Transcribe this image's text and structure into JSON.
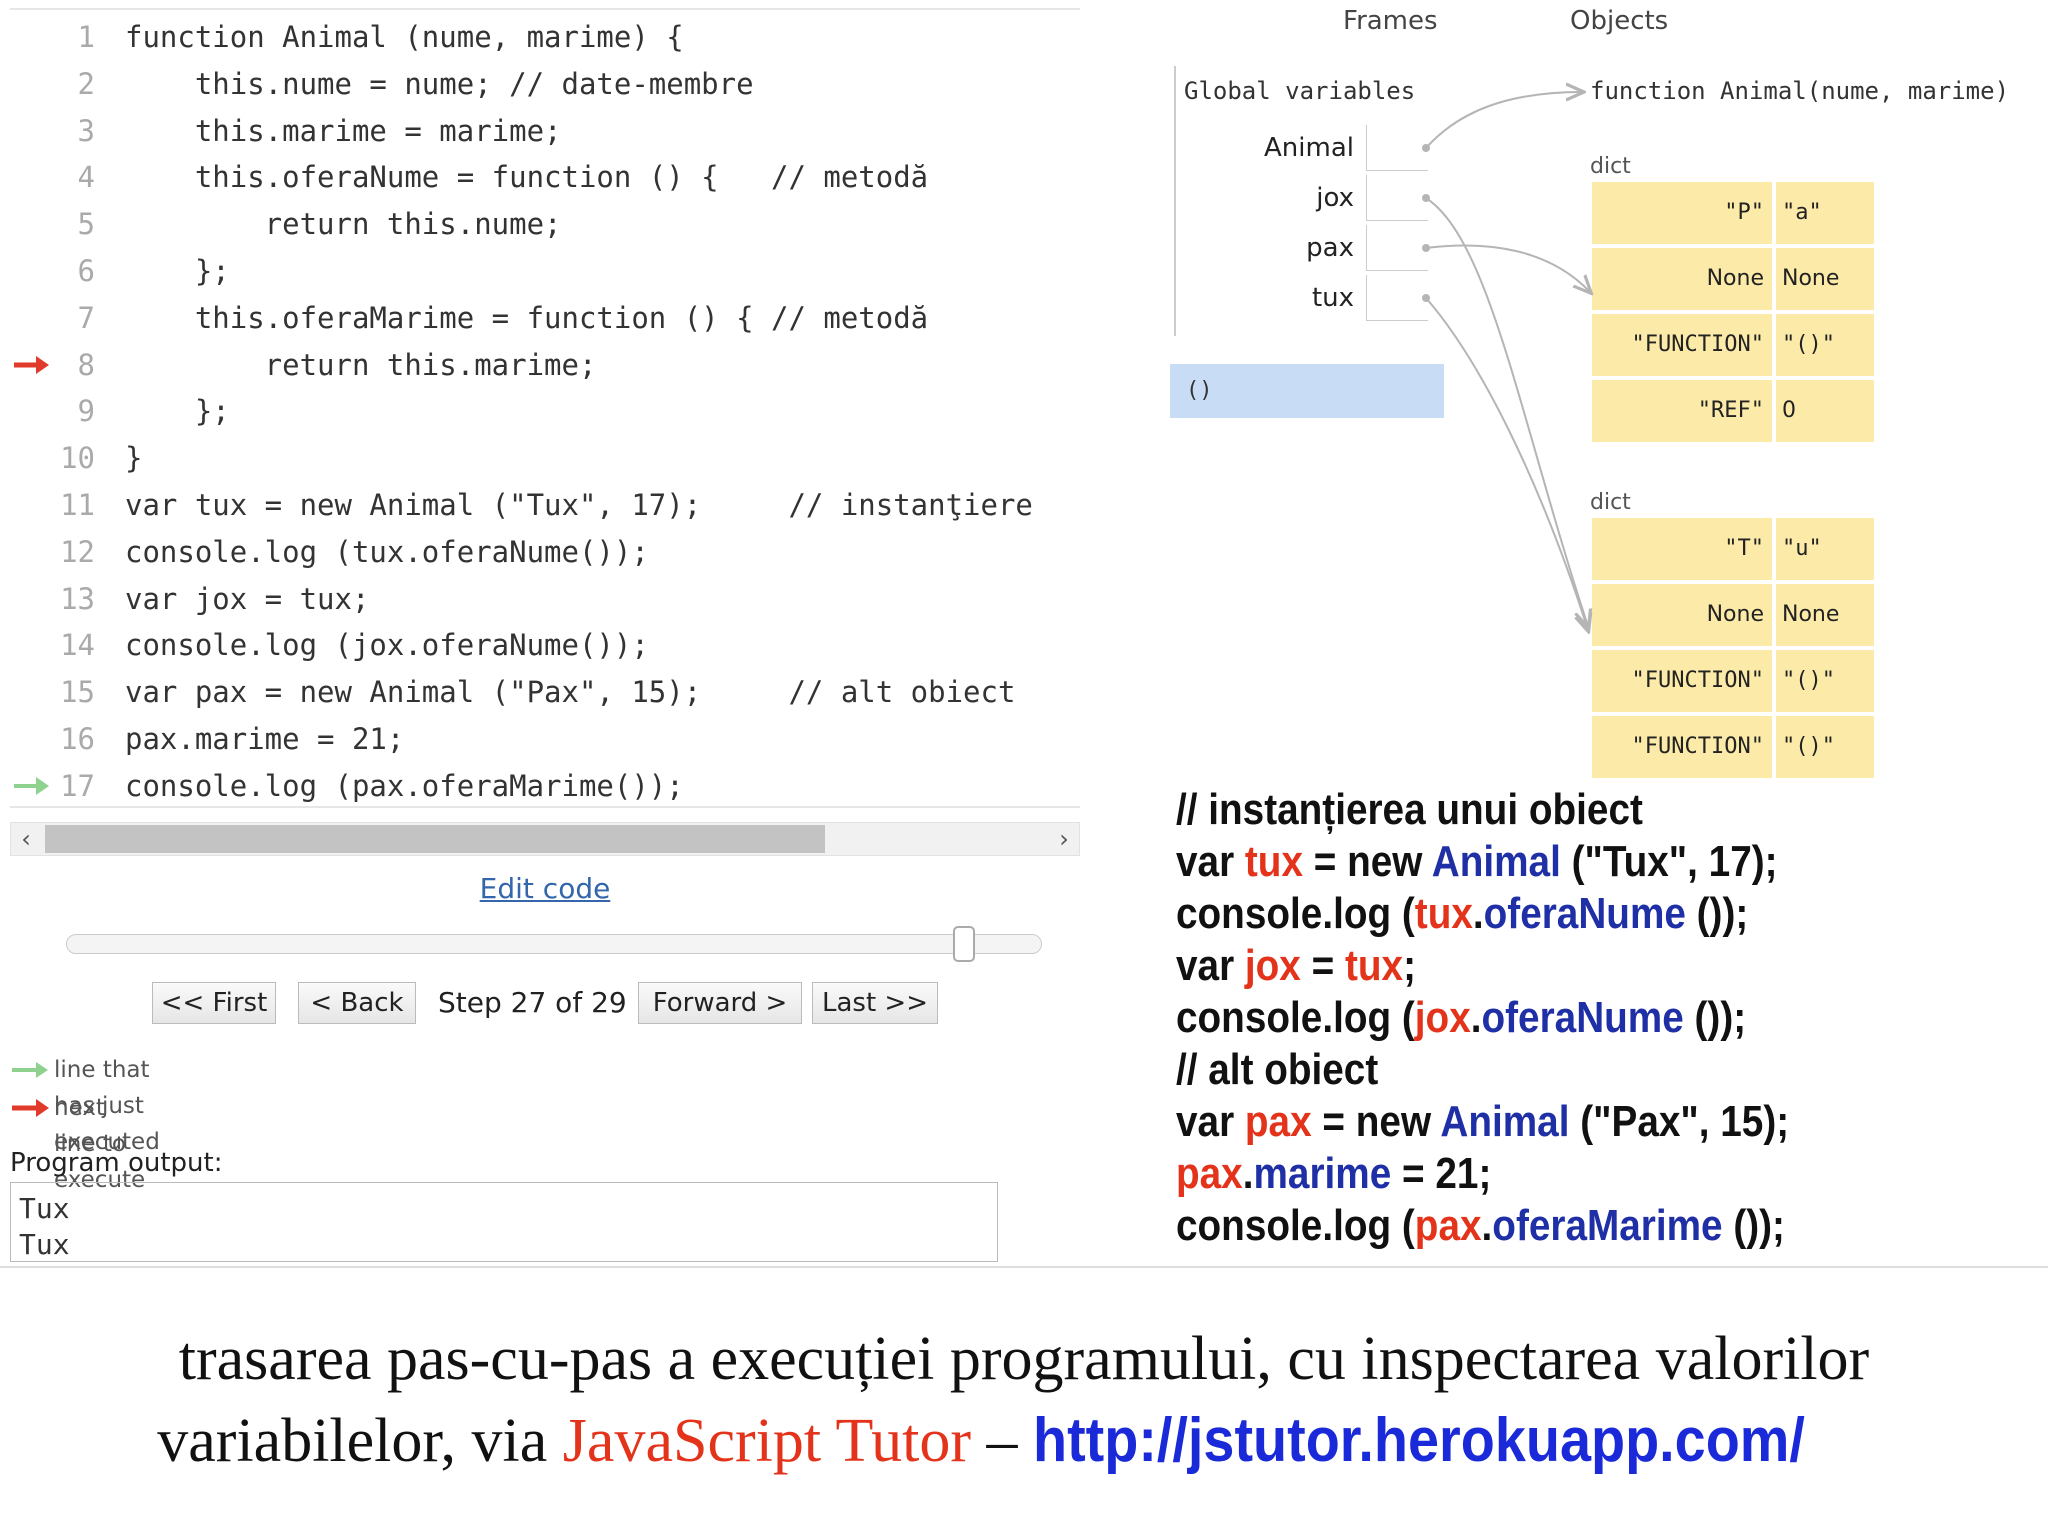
{
  "code": {
    "lines": [
      {
        "num": "1",
        "text": "function Animal (nume, marime) {"
      },
      {
        "num": "2",
        "text": "    this.nume = nume; // date-membre"
      },
      {
        "num": "3",
        "text": "    this.marime = marime;"
      },
      {
        "num": "4",
        "text": "    this.oferaNume = function () {   // metodă"
      },
      {
        "num": "5",
        "text": "        return this.nume;"
      },
      {
        "num": "6",
        "text": "    };"
      },
      {
        "num": "7",
        "text": "    this.oferaMarime = function () { // metodă"
      },
      {
        "num": "8",
        "text": "        return this.marime;"
      },
      {
        "num": "9",
        "text": "    };"
      },
      {
        "num": "10",
        "text": "}"
      },
      {
        "num": "11",
        "text": "var tux = new Animal (\"Tux\", 17);     // instanţiere"
      },
      {
        "num": "12",
        "text": "console.log (tux.oferaNume());"
      },
      {
        "num": "13",
        "text": "var jox = tux;"
      },
      {
        "num": "14",
        "text": "console.log (jox.oferaNume());"
      },
      {
        "num": "15",
        "text": "var pax = new Animal (\"Pax\", 15);     // alt obiect"
      },
      {
        "num": "16",
        "text": "pax.marime = 21;"
      },
      {
        "num": "17",
        "text": "console.log (pax.oferaMarime());"
      }
    ],
    "next_line": 8,
    "just_executed_line": 17
  },
  "controls": {
    "edit_code": "Edit code",
    "first": "<< First",
    "back": "< Back",
    "step": "Step 27 of 29",
    "forward": "Forward >",
    "last": "Last >>",
    "step_current": 27,
    "step_total": 29
  },
  "legend": {
    "just_executed": "line that has just executed",
    "next_line": "next line to execute",
    "just_executed_color": "#8fd18f",
    "next_line_color": "#e03a2b"
  },
  "output": {
    "label": "Program output:",
    "text": "Tux\nTux"
  },
  "visualizer": {
    "frames_title": "Frames",
    "objects_title": "Objects",
    "global_title": "Global variables",
    "variables": [
      "Animal",
      "jox",
      "pax",
      "tux"
    ],
    "call_frame": "()",
    "function_label": "function Animal(nume, marime)",
    "dicts": [
      {
        "label": "dict",
        "rows": [
          {
            "key": "\"P\"",
            "value": "\"a\""
          },
          {
            "key": "None",
            "value": "None"
          },
          {
            "key": "\"FUNCTION\"",
            "value": "\"()\""
          },
          {
            "key": "\"REF\"",
            "value": "0"
          }
        ]
      },
      {
        "label": "dict",
        "rows": [
          {
            "key": "\"T\"",
            "value": "\"u\""
          },
          {
            "key": "None",
            "value": "None"
          },
          {
            "key": "\"FUNCTION\"",
            "value": "\"()\""
          },
          {
            "key": "\"FUNCTION\"",
            "value": "\"()\""
          }
        ]
      }
    ],
    "frame_color": "#c8dcf6",
    "dict_color": "#fbeaa8"
  },
  "snippet": {
    "line1": "// instanțierea unui obiect",
    "l2_var": "var ",
    "l2_tux": "tux",
    "l2_eq": " = new ",
    "l2_animal": "Animal",
    "l2_args": " (\"Tux\", 17);",
    "l3_log": "console.log (",
    "l3_tux": "tux",
    "l3_dot": ".",
    "l3_method": "oferaNume",
    "l3_end": " ());",
    "l4_var": "var ",
    "l4_jox": "jox",
    "l4_eq": " = ",
    "l4_tux": "tux",
    "l4_end": ";",
    "l5_log": "console.log (",
    "l5_jox": "jox",
    "l5_dot": ".",
    "l5_method": "oferaNume",
    "l5_end": " ());",
    "line6": "// alt obiect",
    "l7_var": "var ",
    "l7_pax": "pax",
    "l7_eq": " = new ",
    "l7_animal": "Animal",
    "l7_args": " (\"Pax\", 15);",
    "l8_pax": "pax",
    "l8_dot": ".",
    "l8_field": "marime",
    "l8_end": " = 21;",
    "l9_log": "console.log (",
    "l9_pax": "pax",
    "l9_dot": ".",
    "l9_method": "oferaMarime",
    "l9_end": " ());",
    "var_color": "#e4331b",
    "identifier_color": "#1f2fa6"
  },
  "caption": {
    "line1": "trasarea pas-cu-pas a execuției programului, cu inspectarea valorilor",
    "line2_prefix": "variabilelor, via ",
    "tool": "JavaScript Tutor",
    "dash": " – ",
    "url": "http://jstutor.herokuapp.com/"
  }
}
